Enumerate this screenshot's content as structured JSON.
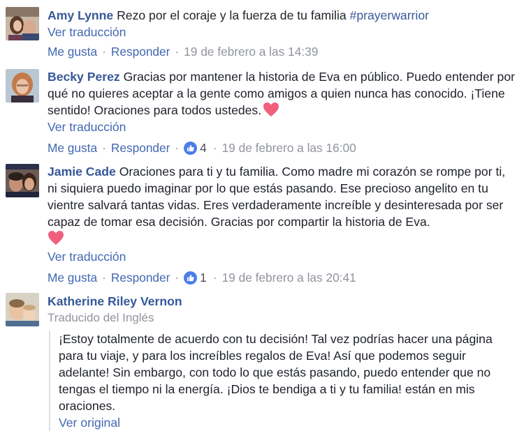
{
  "comments": [
    {
      "author": "Amy Lynne",
      "text": "Rezo por el coraje y la fuerza de tu familia ",
      "hashtag": "#prayerwarrior",
      "see_translation": "Ver traducción",
      "like": "Me gusta",
      "reply": "Responder",
      "timestamp": "19 de febrero a las 14:39"
    },
    {
      "author": "Becky Perez",
      "text": "Gracias por mantener la historia de Eva en público. Puedo entender por qué no quieres aceptar a la gente como amigos a quien nunca has conocido. ¡Tiene sentido! Oraciones para todos ustedes.",
      "see_translation": "Ver traducción",
      "like": "Me gusta",
      "reply": "Responder",
      "like_count": "4",
      "timestamp": "19 de febrero a las 16:00"
    },
    {
      "author": "Jamie Cade",
      "text": "Oraciones para ti y tu familia. Como madre mi corazón se rompe por ti, ni siquiera puedo imaginar por lo que estás pasando. Ese precioso angelito en tu vientre salvará tantas vidas. Eres verdaderamente increíble y desinteresada por ser capaz de tomar esa decisión. Gracias por compartir la historia de Eva.",
      "see_translation": "Ver traducción",
      "like": "Me gusta",
      "reply": "Responder",
      "like_count": "1",
      "timestamp": "19 de febrero a las 20:41"
    },
    {
      "author": "Katherine Riley Vernon",
      "translated_from": "Traducido del Inglés",
      "text": "¡Estoy totalmente de acuerdo con tu decisión! Tal vez podrías hacer una página para tu viaje, y para los increíbles regalos de Eva! Así que podemos seguir adelante! Sin embargo, con todo lo que estás pasando, puedo entender que no tengas el tiempo ni la energía. ¡Dios te bendiga a ti y tu familia! están en mis oraciones.",
      "see_original": "Ver original"
    }
  ],
  "separator": "·",
  "colors": {
    "link": "#4267b2",
    "author": "#365899",
    "meta": "#90949c",
    "like_badge": "#4a7ee8",
    "heart": "#f0607c"
  },
  "icons": [
    "like-thumb-icon",
    "heart-emoji-icon"
  ]
}
